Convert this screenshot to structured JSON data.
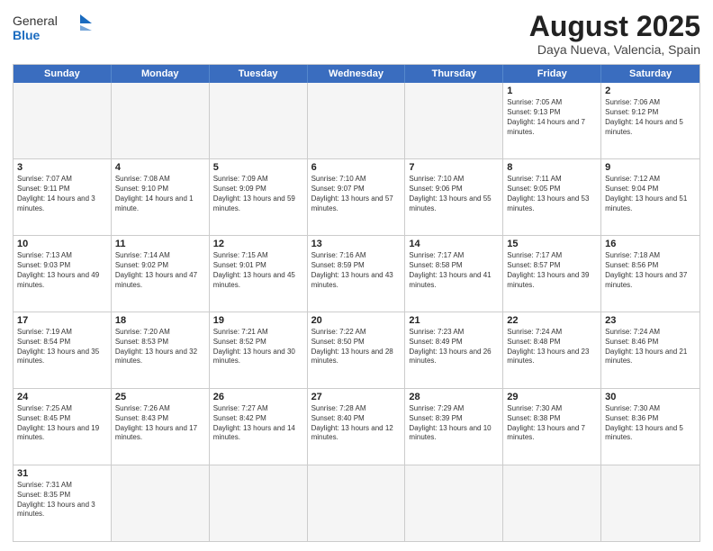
{
  "logo": {
    "text_general": "General",
    "text_blue": "Blue"
  },
  "header": {
    "title": "August 2025",
    "subtitle": "Daya Nueva, Valencia, Spain"
  },
  "days_of_week": [
    "Sunday",
    "Monday",
    "Tuesday",
    "Wednesday",
    "Thursday",
    "Friday",
    "Saturday"
  ],
  "weeks": [
    [
      {
        "day": "",
        "empty": true
      },
      {
        "day": "",
        "empty": true
      },
      {
        "day": "",
        "empty": true
      },
      {
        "day": "",
        "empty": true
      },
      {
        "day": "",
        "empty": true
      },
      {
        "day": "1",
        "sunrise": "7:05 AM",
        "sunset": "9:13 PM",
        "daylight": "14 hours and 7 minutes."
      },
      {
        "day": "2",
        "sunrise": "7:06 AM",
        "sunset": "9:12 PM",
        "daylight": "14 hours and 5 minutes."
      }
    ],
    [
      {
        "day": "3",
        "sunrise": "7:07 AM",
        "sunset": "9:11 PM",
        "daylight": "14 hours and 3 minutes."
      },
      {
        "day": "4",
        "sunrise": "7:08 AM",
        "sunset": "9:10 PM",
        "daylight": "14 hours and 1 minute."
      },
      {
        "day": "5",
        "sunrise": "7:09 AM",
        "sunset": "9:09 PM",
        "daylight": "13 hours and 59 minutes."
      },
      {
        "day": "6",
        "sunrise": "7:10 AM",
        "sunset": "9:07 PM",
        "daylight": "13 hours and 57 minutes."
      },
      {
        "day": "7",
        "sunrise": "7:10 AM",
        "sunset": "9:06 PM",
        "daylight": "13 hours and 55 minutes."
      },
      {
        "day": "8",
        "sunrise": "7:11 AM",
        "sunset": "9:05 PM",
        "daylight": "13 hours and 53 minutes."
      },
      {
        "day": "9",
        "sunrise": "7:12 AM",
        "sunset": "9:04 PM",
        "daylight": "13 hours and 51 minutes."
      }
    ],
    [
      {
        "day": "10",
        "sunrise": "7:13 AM",
        "sunset": "9:03 PM",
        "daylight": "13 hours and 49 minutes."
      },
      {
        "day": "11",
        "sunrise": "7:14 AM",
        "sunset": "9:02 PM",
        "daylight": "13 hours and 47 minutes."
      },
      {
        "day": "12",
        "sunrise": "7:15 AM",
        "sunset": "9:01 PM",
        "daylight": "13 hours and 45 minutes."
      },
      {
        "day": "13",
        "sunrise": "7:16 AM",
        "sunset": "8:59 PM",
        "daylight": "13 hours and 43 minutes."
      },
      {
        "day": "14",
        "sunrise": "7:17 AM",
        "sunset": "8:58 PM",
        "daylight": "13 hours and 41 minutes."
      },
      {
        "day": "15",
        "sunrise": "7:17 AM",
        "sunset": "8:57 PM",
        "daylight": "13 hours and 39 minutes."
      },
      {
        "day": "16",
        "sunrise": "7:18 AM",
        "sunset": "8:56 PM",
        "daylight": "13 hours and 37 minutes."
      }
    ],
    [
      {
        "day": "17",
        "sunrise": "7:19 AM",
        "sunset": "8:54 PM",
        "daylight": "13 hours and 35 minutes."
      },
      {
        "day": "18",
        "sunrise": "7:20 AM",
        "sunset": "8:53 PM",
        "daylight": "13 hours and 32 minutes."
      },
      {
        "day": "19",
        "sunrise": "7:21 AM",
        "sunset": "8:52 PM",
        "daylight": "13 hours and 30 minutes."
      },
      {
        "day": "20",
        "sunrise": "7:22 AM",
        "sunset": "8:50 PM",
        "daylight": "13 hours and 28 minutes."
      },
      {
        "day": "21",
        "sunrise": "7:23 AM",
        "sunset": "8:49 PM",
        "daylight": "13 hours and 26 minutes."
      },
      {
        "day": "22",
        "sunrise": "7:24 AM",
        "sunset": "8:48 PM",
        "daylight": "13 hours and 23 minutes."
      },
      {
        "day": "23",
        "sunrise": "7:24 AM",
        "sunset": "8:46 PM",
        "daylight": "13 hours and 21 minutes."
      }
    ],
    [
      {
        "day": "24",
        "sunrise": "7:25 AM",
        "sunset": "8:45 PM",
        "daylight": "13 hours and 19 minutes."
      },
      {
        "day": "25",
        "sunrise": "7:26 AM",
        "sunset": "8:43 PM",
        "daylight": "13 hours and 17 minutes."
      },
      {
        "day": "26",
        "sunrise": "7:27 AM",
        "sunset": "8:42 PM",
        "daylight": "13 hours and 14 minutes."
      },
      {
        "day": "27",
        "sunrise": "7:28 AM",
        "sunset": "8:40 PM",
        "daylight": "13 hours and 12 minutes."
      },
      {
        "day": "28",
        "sunrise": "7:29 AM",
        "sunset": "8:39 PM",
        "daylight": "13 hours and 10 minutes."
      },
      {
        "day": "29",
        "sunrise": "7:30 AM",
        "sunset": "8:38 PM",
        "daylight": "13 hours and 7 minutes."
      },
      {
        "day": "30",
        "sunrise": "7:30 AM",
        "sunset": "8:36 PM",
        "daylight": "13 hours and 5 minutes."
      }
    ],
    [
      {
        "day": "31",
        "sunrise": "7:31 AM",
        "sunset": "8:35 PM",
        "daylight": "13 hours and 3 minutes."
      },
      {
        "day": "",
        "empty": true
      },
      {
        "day": "",
        "empty": true
      },
      {
        "day": "",
        "empty": true
      },
      {
        "day": "",
        "empty": true
      },
      {
        "day": "",
        "empty": true
      },
      {
        "day": "",
        "empty": true
      }
    ]
  ]
}
